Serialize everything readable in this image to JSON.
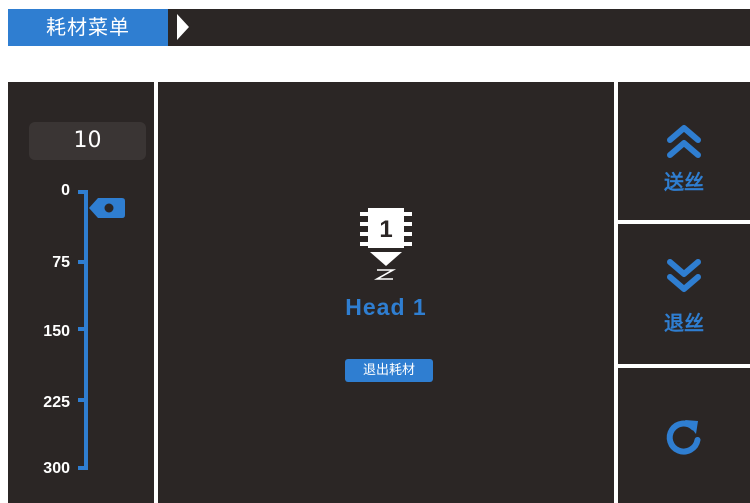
{
  "header": {
    "title": "耗材菜单"
  },
  "ruler": {
    "current_value": "10",
    "ticks": [
      "0",
      "75",
      "150",
      "225",
      "300"
    ],
    "pointer_value": 10
  },
  "head": {
    "number": "1",
    "label": "Head 1",
    "exit_button": "退出耗材"
  },
  "actions": {
    "feed_label": "送丝",
    "retract_label": "退丝"
  },
  "colors": {
    "accent": "#2f7ed1",
    "panel": "#2b2625",
    "value_box": "#3a3534",
    "text": "#ffffff",
    "background": "#ffffff"
  },
  "icons": {
    "breadcrumb": "triangle-right-icon",
    "head": "extruder-head-icon",
    "feed": "double-chevron-up-icon",
    "retract": "double-chevron-down-icon",
    "reset": "refresh-icon",
    "pointer": "slider-pointer-icon"
  }
}
